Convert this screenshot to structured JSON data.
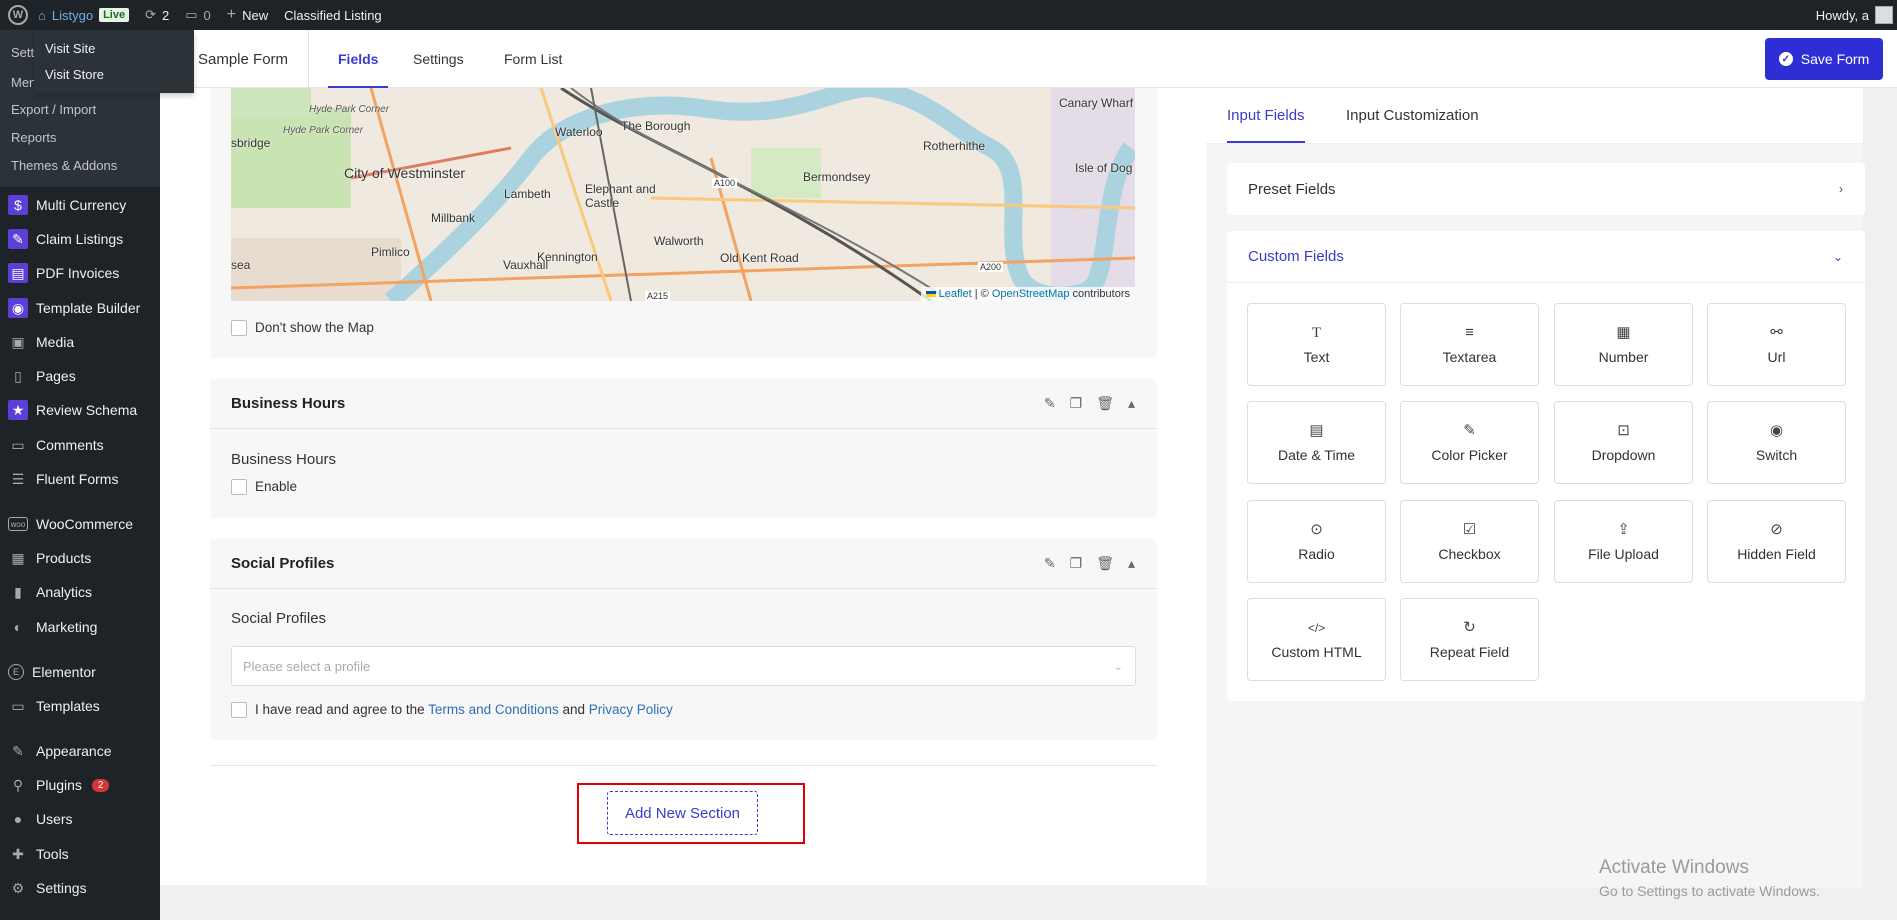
{
  "adminbar": {
    "site_name": "Listygo",
    "live_badge": "Live",
    "updates_count": "2",
    "comments_count": "0",
    "new_label": "New",
    "classified_label": "Classified Listing",
    "howdy": "Howdy, a"
  },
  "site_menu": {
    "visit_site": "Visit Site",
    "visit_store": "Visit Store"
  },
  "sidebar": {
    "sub_items": [
      "Sett",
      "Men",
      "Export / Import",
      "Reports",
      "Themes & Addons"
    ],
    "items": [
      {
        "label": "Multi Currency",
        "icon": "dollar-icon"
      },
      {
        "label": "Claim Listings",
        "icon": "claim-icon"
      },
      {
        "label": "PDF Invoices",
        "icon": "pdf-icon"
      },
      {
        "label": "Template Builder",
        "icon": "template-builder-icon"
      },
      {
        "label": "Media",
        "icon": "media-icon"
      },
      {
        "label": "Pages",
        "icon": "pages-icon"
      },
      {
        "label": "Review Schema",
        "icon": "review-icon"
      },
      {
        "label": "Comments",
        "icon": "comments-icon"
      },
      {
        "label": "Fluent Forms",
        "icon": "forms-icon"
      },
      {
        "label": "WooCommerce",
        "icon": "woocommerce-icon"
      },
      {
        "label": "Products",
        "icon": "products-icon"
      },
      {
        "label": "Analytics",
        "icon": "analytics-icon"
      },
      {
        "label": "Marketing",
        "icon": "marketing-icon"
      },
      {
        "label": "Elementor",
        "icon": "elementor-icon"
      },
      {
        "label": "Templates",
        "icon": "templates-icon"
      },
      {
        "label": "Appearance",
        "icon": "appearance-icon"
      },
      {
        "label": "Plugins",
        "icon": "plugins-icon",
        "badge": "2"
      },
      {
        "label": "Users",
        "icon": "users-icon"
      },
      {
        "label": "Tools",
        "icon": "tools-icon"
      },
      {
        "label": "Settings",
        "icon": "settings-icon"
      }
    ]
  },
  "header": {
    "form_title": "Sample Form",
    "tabs": [
      "Fields",
      "Settings",
      "Form List"
    ],
    "save_label": "Save Form"
  },
  "map": {
    "labels": [
      "Hyde Park Corner",
      "Hyde Park Corner",
      "sbridge",
      "City of Westminster",
      "Waterloo",
      "The Borough",
      "Lambeth",
      "Elephant and Castle",
      "Millbank",
      "Bermondsey",
      "Rotherhithe",
      "Canary Wharf",
      "Isle of Dog",
      "Pimlico",
      "Vauxhall",
      "Kennington",
      "Walworth",
      "Old Kent Road",
      "A100",
      "A200",
      "A215",
      "sea"
    ],
    "attribution_leaflet": "Leaflet",
    "attribution_mid": " | © ",
    "attribution_osm": "OpenStreetMap",
    "attribution_end": " contributors",
    "hide_map_label": "Don't show the Map"
  },
  "business_hours": {
    "title": "Business Hours",
    "label": "Business Hours",
    "enable_label": "Enable"
  },
  "social_profiles": {
    "title": "Social Profiles",
    "label": "Social Profiles",
    "placeholder": "Please select a profile",
    "agree_prefix": "I have read and agree to the ",
    "terms_link": "Terms and Conditions",
    "agree_and": " and ",
    "privacy_link": "Privacy Policy"
  },
  "add_section_label": "Add New Section",
  "right_panel": {
    "tabs": [
      "Input Fields",
      "Input Customization"
    ],
    "preset_fields": "Preset Fields",
    "custom_fields": "Custom Fields",
    "tiles": [
      {
        "label": "Text",
        "icon": "text-icon",
        "glyph": "T"
      },
      {
        "label": "Textarea",
        "icon": "textarea-icon",
        "glyph": "≡"
      },
      {
        "label": "Number",
        "icon": "number-icon",
        "glyph": "▦"
      },
      {
        "label": "Url",
        "icon": "link-icon",
        "glyph": "⚯"
      },
      {
        "label": "Date & Time",
        "icon": "calendar-icon",
        "glyph": "▤"
      },
      {
        "label": "Color Picker",
        "icon": "eyedropper-icon",
        "glyph": "✎"
      },
      {
        "label": "Dropdown",
        "icon": "dropdown-icon",
        "glyph": "⊡"
      },
      {
        "label": "Switch",
        "icon": "toggle-icon",
        "glyph": "◉"
      },
      {
        "label": "Radio",
        "icon": "radio-icon",
        "glyph": "⊙"
      },
      {
        "label": "Checkbox",
        "icon": "checkbox-icon",
        "glyph": "☑"
      },
      {
        "label": "File Upload",
        "icon": "upload-icon",
        "glyph": "⇪"
      },
      {
        "label": "Hidden Field",
        "icon": "eye-slash-icon",
        "glyph": "⊘"
      },
      {
        "label": "Custom HTML",
        "icon": "code-icon",
        "glyph": "</>"
      },
      {
        "label": "Repeat Field",
        "icon": "repeat-icon",
        "glyph": "↻"
      }
    ]
  },
  "watermark": {
    "line1": "Activate Windows",
    "line2": "Go to Settings to activate Windows."
  }
}
